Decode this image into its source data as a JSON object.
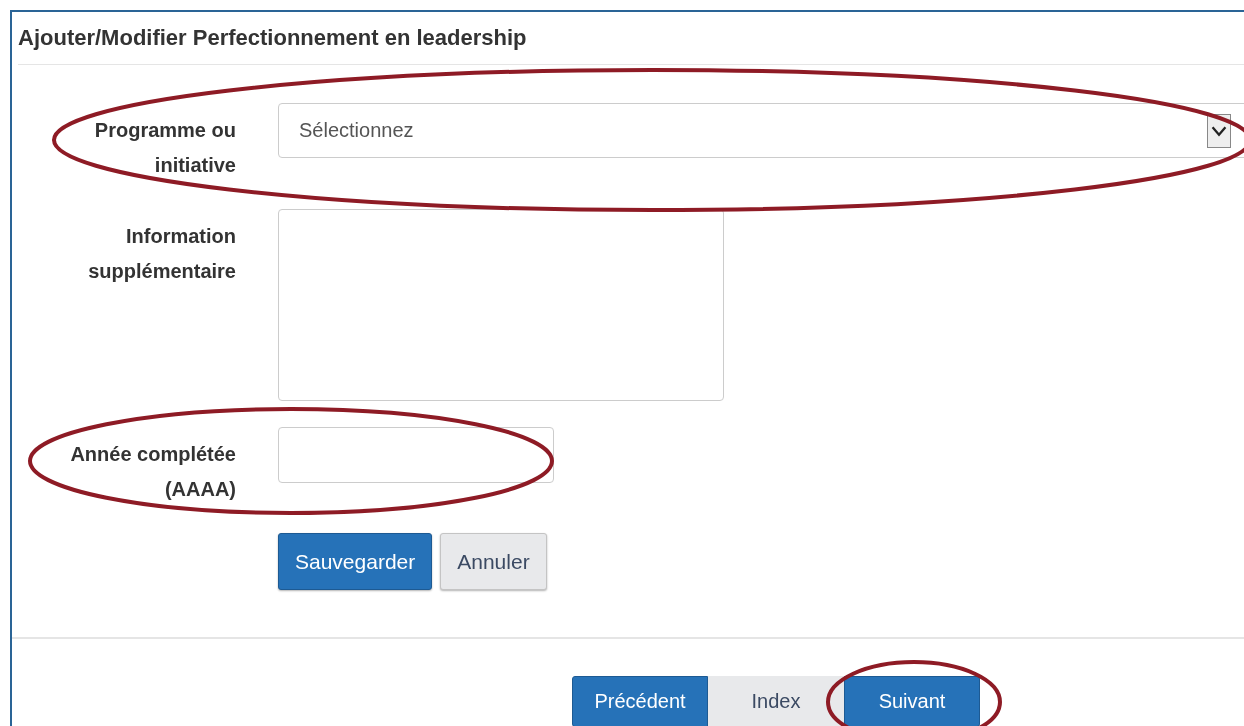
{
  "title": "Ajouter/Modifier Perfectionnement en leadership",
  "fields": [
    {
      "kind": "select",
      "label": "Programme ou initiative",
      "placeholder": "Sélectionnez",
      "circled": true
    },
    {
      "kind": "textarea",
      "label": "Information supplémentaire",
      "circled": false
    },
    {
      "kind": "text",
      "label": "Année complétée (AAAA)",
      "circled": true
    }
  ],
  "form_buttons": [
    {
      "label": "Sauvegarder",
      "kind": "primary"
    },
    {
      "label": "Annuler",
      "kind": "default"
    }
  ],
  "nav_buttons": [
    {
      "label": "Précédent",
      "kind": "primary",
      "circled": false
    },
    {
      "label": "Index",
      "kind": "default",
      "circled": false
    },
    {
      "label": "Suivant",
      "kind": "primary",
      "circled": true
    }
  ]
}
